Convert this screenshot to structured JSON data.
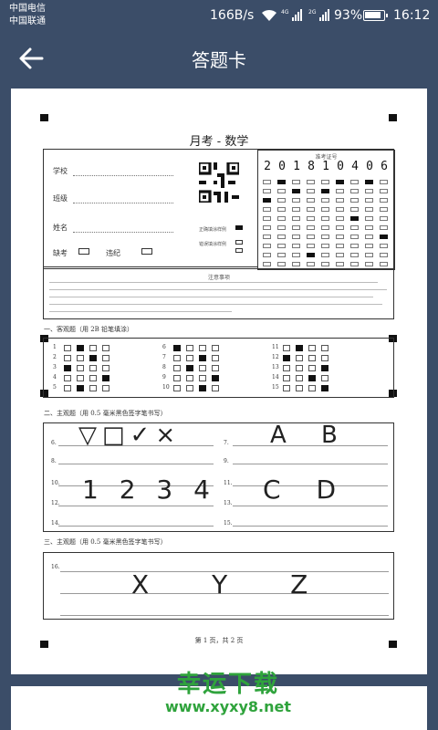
{
  "status_bar": {
    "carrier_1": "中国电信",
    "carrier_2": "中国联通",
    "network_speed": "166B/s",
    "battery_percent": "93%",
    "time": "16:12",
    "icons": [
      "wifi-icon",
      "signal-4g-icon",
      "signal-2g-icon",
      "battery-icon"
    ]
  },
  "app_bar": {
    "title": "答题卡",
    "back_icon": "back-arrow-icon"
  },
  "sheet": {
    "exam_title": "月考 - 数学",
    "fields": {
      "school": "学校",
      "class": "班级",
      "name": "姓名",
      "absent": "缺考",
      "violation": "违纪"
    },
    "exam_number_label": "准考证号",
    "exam_number_digits": [
      "2",
      "0",
      "1",
      "8",
      "1",
      "0",
      "4",
      "0",
      "6"
    ],
    "fill_sample_correct": "正确填涂样例",
    "fill_sample_wrong": "错误填涂样例",
    "notes_title": "注意事项",
    "section_1": "一、客观题（用 2B 铅笔填涂）",
    "section_2": "二、主观题（用 0.5 毫米黑色签字笔书写）",
    "section_3": "三、主观题（用 0.5 毫米黑色签字笔书写）",
    "options": [
      "A",
      "B",
      "C",
      "D"
    ],
    "handwriting": {
      "q6_shapes": "▽□✓×",
      "q7_letters": "A B",
      "q9_digits": "1 2 3 4",
      "q10_letters": "C D",
      "q16_letters": "X Y Z"
    },
    "page_footer": "第 1 页，共 2 页"
  },
  "watermark": {
    "line1": "幸运下载",
    "line2": "www.xyxy8.net"
  }
}
